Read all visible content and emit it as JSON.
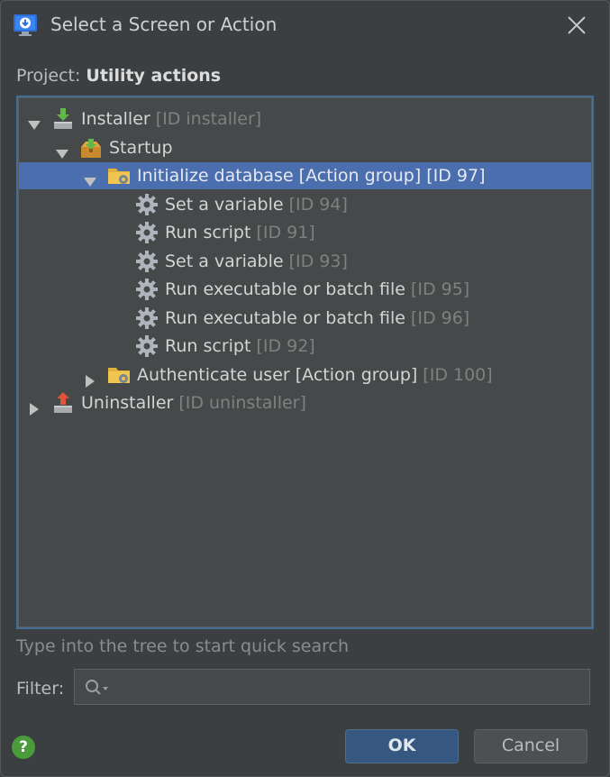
{
  "window": {
    "title": "Select a Screen or Action",
    "icon": "monitor-download-icon",
    "close_icon": "close-icon"
  },
  "project": {
    "label": "Project:",
    "name": "Utility actions"
  },
  "tree": {
    "selection_color": "#4b6eaf",
    "rows": [
      {
        "label": "Installer",
        "id": "[ID installer]",
        "icon": "installer-icon",
        "expanded": true,
        "depth": 0
      },
      {
        "label": "Startup",
        "id": "",
        "icon": "startup-icon",
        "expanded": true,
        "depth": 1
      },
      {
        "label": "Initialize database [Action group]",
        "id": "[ID 97]",
        "icon": "action-group-folder-icon",
        "expanded": true,
        "depth": 2,
        "selected": true
      },
      {
        "label": "Set a variable",
        "id": "[ID 94]",
        "icon": "gear-icon",
        "depth": 3
      },
      {
        "label": "Run script",
        "id": "[ID 91]",
        "icon": "gear-icon",
        "depth": 3
      },
      {
        "label": "Set a variable",
        "id": "[ID 93]",
        "icon": "gear-icon",
        "depth": 3
      },
      {
        "label": "Run executable or batch file",
        "id": "[ID 95]",
        "icon": "gear-icon",
        "depth": 3
      },
      {
        "label": "Run executable or batch file",
        "id": "[ID 96]",
        "icon": "gear-icon",
        "depth": 3
      },
      {
        "label": "Run script",
        "id": "[ID 92]",
        "icon": "gear-icon",
        "depth": 3
      },
      {
        "label": "Authenticate user [Action group]",
        "id": "[ID 100]",
        "icon": "action-group-folder-icon",
        "expanded": false,
        "depth": 2
      },
      {
        "label": "Uninstaller",
        "id": "[ID uninstaller]",
        "icon": "uninstaller-icon",
        "expanded": false,
        "depth": 0
      }
    ]
  },
  "hint": "Type into the tree to start quick search",
  "filter": {
    "label": "Filter:",
    "value": "",
    "placeholder": ""
  },
  "buttons": {
    "ok": "OK",
    "cancel": "Cancel",
    "help": "?"
  }
}
